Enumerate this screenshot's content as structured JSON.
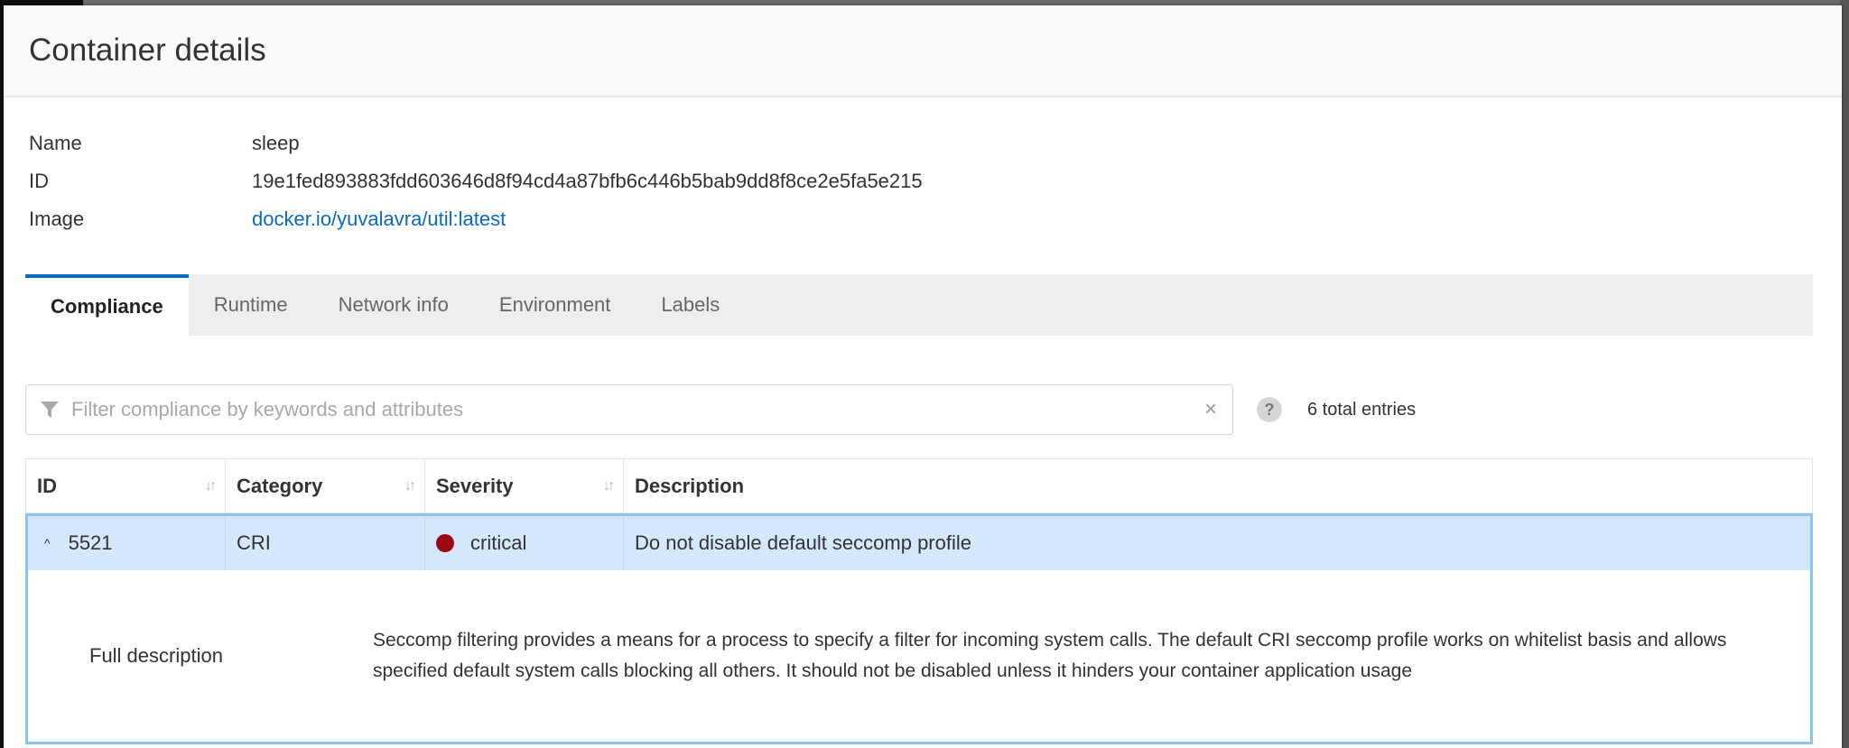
{
  "modal": {
    "title": "Container details"
  },
  "details": [
    {
      "label": "Name",
      "value": "sleep",
      "is_link": false
    },
    {
      "label": "ID",
      "value": "19e1fed893883fdd603646d8f94cd4a87bfb6c446b5bab9dd8f8ce2e5fa5e215",
      "is_link": false
    },
    {
      "label": "Image",
      "value": "docker.io/yuvalavra/util:latest",
      "is_link": true
    }
  ],
  "tabs": [
    {
      "label": "Compliance",
      "active": true
    },
    {
      "label": "Runtime",
      "active": false
    },
    {
      "label": "Network info",
      "active": false
    },
    {
      "label": "Environment",
      "active": false
    },
    {
      "label": "Labels",
      "active": false
    }
  ],
  "filter": {
    "placeholder": "Filter compliance by keywords and attributes",
    "value": "",
    "icon": "filter-icon",
    "clear_label": "×",
    "help_label": "?",
    "total_entries": "6 total entries"
  },
  "table": {
    "columns": [
      {
        "label": "ID",
        "sortable": true,
        "sort_icon": "↓↑"
      },
      {
        "label": "Category",
        "sortable": true,
        "sort_icon": "↓↑"
      },
      {
        "label": "Severity",
        "sortable": true,
        "sort_icon": "↓↑"
      },
      {
        "label": "Description",
        "sortable": false
      }
    ],
    "rows": [
      {
        "expanded": true,
        "caret": "^",
        "id": "5521",
        "category": "CRI",
        "severity": "critical",
        "severity_color": "#9b0a14",
        "description": "Do not disable default seccomp profile",
        "full_description_label": "Full description",
        "full_description": "Seccomp filtering provides a means for a process to specify a filter for incoming system calls. The default CRI seccomp profile works on whitelist basis and allows specified default system calls blocking all others. It should not be disabled unless it hinders your container application usage"
      }
    ]
  },
  "colors": {
    "accent": "#0a6bc2",
    "row_selected_bg": "#d5e7fb",
    "row_selected_border": "#8cc4f0",
    "critical": "#9b0a14"
  }
}
